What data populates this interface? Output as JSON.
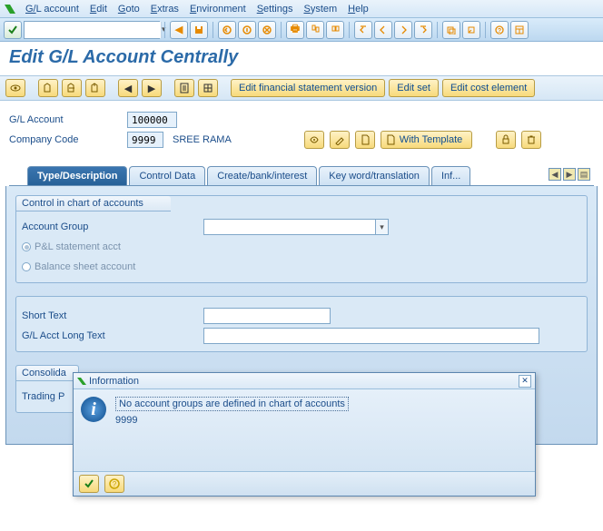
{
  "menu": {
    "items": [
      "G/L account",
      "Edit",
      "Goto",
      "Extras",
      "Environment",
      "Settings",
      "System",
      "Help"
    ]
  },
  "toolbar": {
    "ok_value": ""
  },
  "title": "Edit G/L Account Centrally",
  "actionbar": {
    "btn_fin": "Edit financial statement version",
    "btn_set": "Edit set",
    "btn_cost": "Edit cost element"
  },
  "header": {
    "gl_label": "G/L Account",
    "gl_value": "100000",
    "cc_label": "Company Code",
    "cc_value": "9999",
    "cc_desc": "SREE RAMA",
    "with_template": "With Template"
  },
  "tabs": {
    "t0": "Type/Description",
    "t1": "Control Data",
    "t2": "Create/bank/interest",
    "t3": "Key word/translation",
    "t4": "Inf..."
  },
  "group1": {
    "title": "Control in chart of accounts",
    "account_group_label": "Account Group",
    "account_group_value": "",
    "r1": "P&L statement acct",
    "r2": "Balance sheet account"
  },
  "group2": {
    "short_text_label": "Short Text",
    "short_text_value": "",
    "long_text_label": "G/L Acct Long Text",
    "long_text_value": ""
  },
  "group3": {
    "title": "Consolida",
    "trading": "Trading P"
  },
  "dialog": {
    "title": "Information",
    "msg1": "No account groups are defined in chart of accounts",
    "msg2": "9999"
  }
}
